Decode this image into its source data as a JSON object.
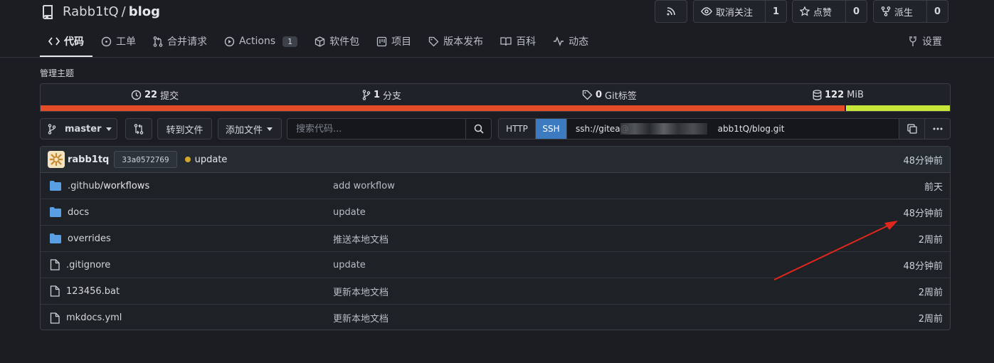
{
  "repo": {
    "owner": "Rabb1tQ",
    "separator": "/",
    "name": "blog"
  },
  "header_buttons": {
    "unwatch_label": "取消关注",
    "unwatch_count": "1",
    "star_label": "点赞",
    "star_count": "0",
    "fork_label": "派生",
    "fork_count": "0"
  },
  "tabs": [
    {
      "label": "代码",
      "icon": "code-icon"
    },
    {
      "label": "工单",
      "icon": "issue-icon"
    },
    {
      "label": "合并请求",
      "icon": "pull-request-icon"
    },
    {
      "label": "Actions",
      "icon": "actions-icon",
      "badge": "1"
    },
    {
      "label": "软件包",
      "icon": "package-icon"
    },
    {
      "label": "项目",
      "icon": "project-icon"
    },
    {
      "label": "版本发布",
      "icon": "tag-icon"
    },
    {
      "label": "百科",
      "icon": "book-icon"
    },
    {
      "label": "动态",
      "icon": "pulse-icon"
    }
  ],
  "settings_label": "设置",
  "manage_topics": "管理主题",
  "stats": {
    "commits_count": "22",
    "commits_label": "提交",
    "branches_count": "1",
    "branches_label": "分支",
    "tags_count": "0",
    "tags_label": "Git标签",
    "size_value": "122",
    "size_unit": "MiB"
  },
  "language_colors": [
    "#e34c26",
    "#c6e63a"
  ],
  "language_fraction": 0.883,
  "toolbar": {
    "branch": "master",
    "goto_file": "转到文件",
    "add_file": "添加文件",
    "search_placeholder": "搜索代码..."
  },
  "clone": {
    "http_label": "HTTP",
    "ssh_label": "SSH",
    "url_prefix": "ssh://gitea@",
    "url_suffix": "abb1tQ/blog.git"
  },
  "latest_commit": {
    "author": "rabb1tq",
    "sha": "33a0572769",
    "message": "update",
    "time": "48分钟前"
  },
  "files": [
    {
      "type": "folder",
      "name": ".github",
      "subpath": "/workflows",
      "message": "add workflow",
      "time": "前天"
    },
    {
      "type": "folder",
      "name": "docs",
      "subpath": "",
      "message": "update",
      "time": "48分钟前"
    },
    {
      "type": "folder",
      "name": "overrides",
      "subpath": "",
      "message": "推送本地文档",
      "time": "2周前"
    },
    {
      "type": "file",
      "name": ".gitignore",
      "subpath": "",
      "message": "update",
      "time": "48分钟前"
    },
    {
      "type": "file",
      "name": "123456.bat",
      "subpath": "",
      "message": "更新本地文档",
      "time": "2周前"
    },
    {
      "type": "file",
      "name": "mkdocs.yml",
      "subpath": "",
      "message": "更新本地文档",
      "time": "2周前"
    }
  ],
  "colors": {
    "accent": "#3c7bc0",
    "folder": "#5a9fe3",
    "annotation_arrow": "#e0261d"
  }
}
